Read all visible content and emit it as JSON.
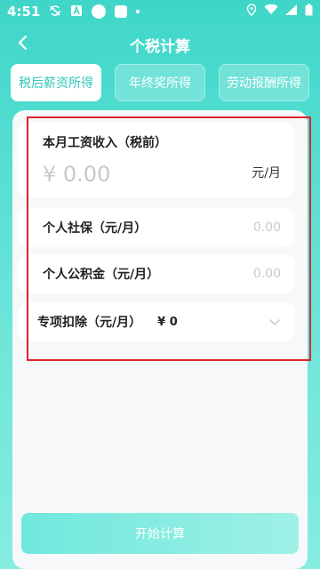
{
  "status_bar": {
    "time": "4:51"
  },
  "nav": {
    "title": "个税计算"
  },
  "tabs": [
    {
      "label": "税后薪资所得",
      "active": true
    },
    {
      "label": "年终奖所得",
      "active": false
    },
    {
      "label": "劳动报酬所得",
      "active": false
    }
  ],
  "income": {
    "label": "本月工资收入（税前）",
    "value": "¥ 0.00",
    "unit": "元/月"
  },
  "social": {
    "label": "个人社保（元/月）",
    "value": "0.00"
  },
  "fund": {
    "label": "个人公积金（元/月）",
    "value": "0.00"
  },
  "special": {
    "label": "专项扣除（元/月）",
    "amount": "¥ 0"
  },
  "start_button": {
    "label": "开始计算"
  },
  "colors": {
    "accent": "#2fc7b8",
    "highlight": "#e0252d"
  }
}
